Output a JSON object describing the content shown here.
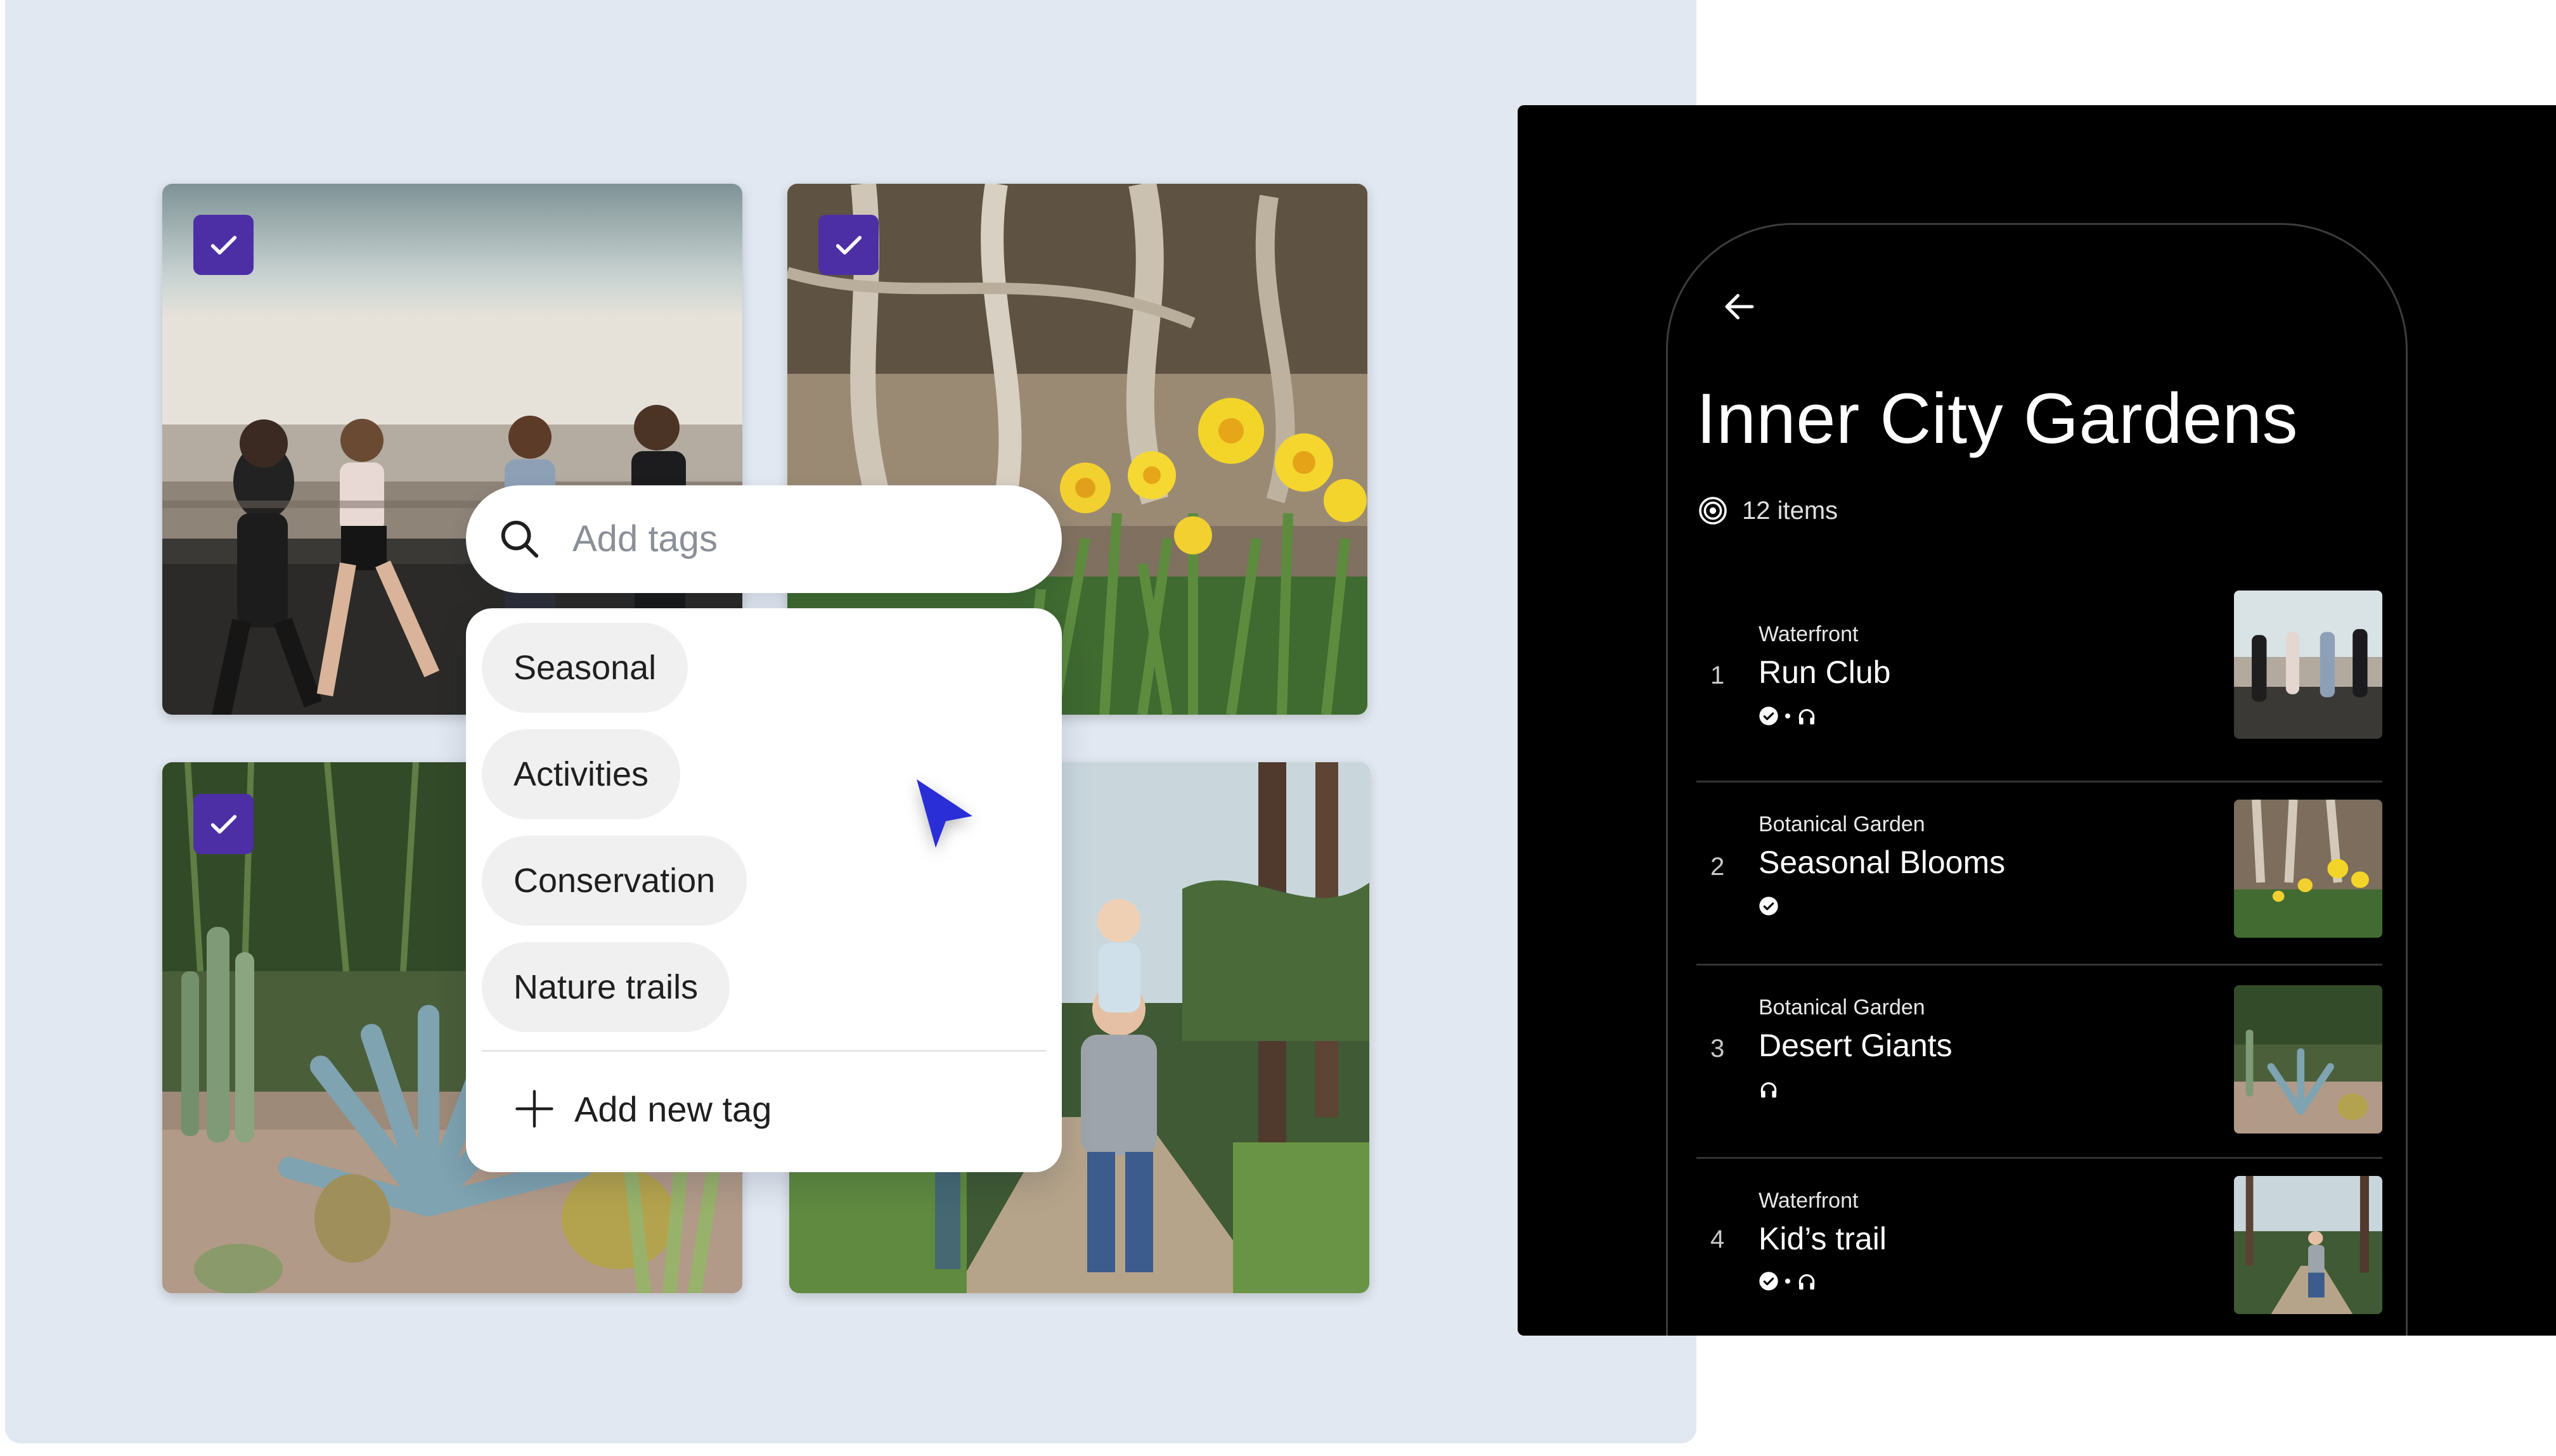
{
  "search": {
    "placeholder": "Add tags"
  },
  "tags": {
    "items": [
      "Seasonal",
      "Activities",
      "Conservation",
      "Nature trails"
    ],
    "add_new_label": "Add new tag"
  },
  "photos": [
    {
      "name": "runners-photo",
      "selected": true
    },
    {
      "name": "daffodils-photo",
      "selected": true
    },
    {
      "name": "cactus-garden-photo",
      "selected": true
    },
    {
      "name": "family-trail-photo",
      "selected": false
    }
  ],
  "phone": {
    "title": "Inner City Gardens",
    "count_label": "12 items",
    "items": [
      {
        "number": "1",
        "category": "Waterfront",
        "title": "Run Club",
        "icons": [
          "verified-icon",
          "headphones-icon"
        ]
      },
      {
        "number": "2",
        "category": "Botanical Garden",
        "title": "Seasonal Blooms",
        "icons": [
          "verified-icon"
        ]
      },
      {
        "number": "3",
        "category": "Botanical Garden",
        "title": "Desert Giants",
        "icons": [
          "headphones-icon"
        ]
      },
      {
        "number": "4",
        "category": "Waterfront",
        "title": "Kid’s trail",
        "icons": [
          "verified-icon",
          "headphones-icon"
        ]
      }
    ]
  },
  "colors": {
    "panel_background": "#e2e8f1",
    "checkbox_accent": "#4c2fa5",
    "cursor": "#2a2ed6",
    "phone_background": "#000000"
  }
}
